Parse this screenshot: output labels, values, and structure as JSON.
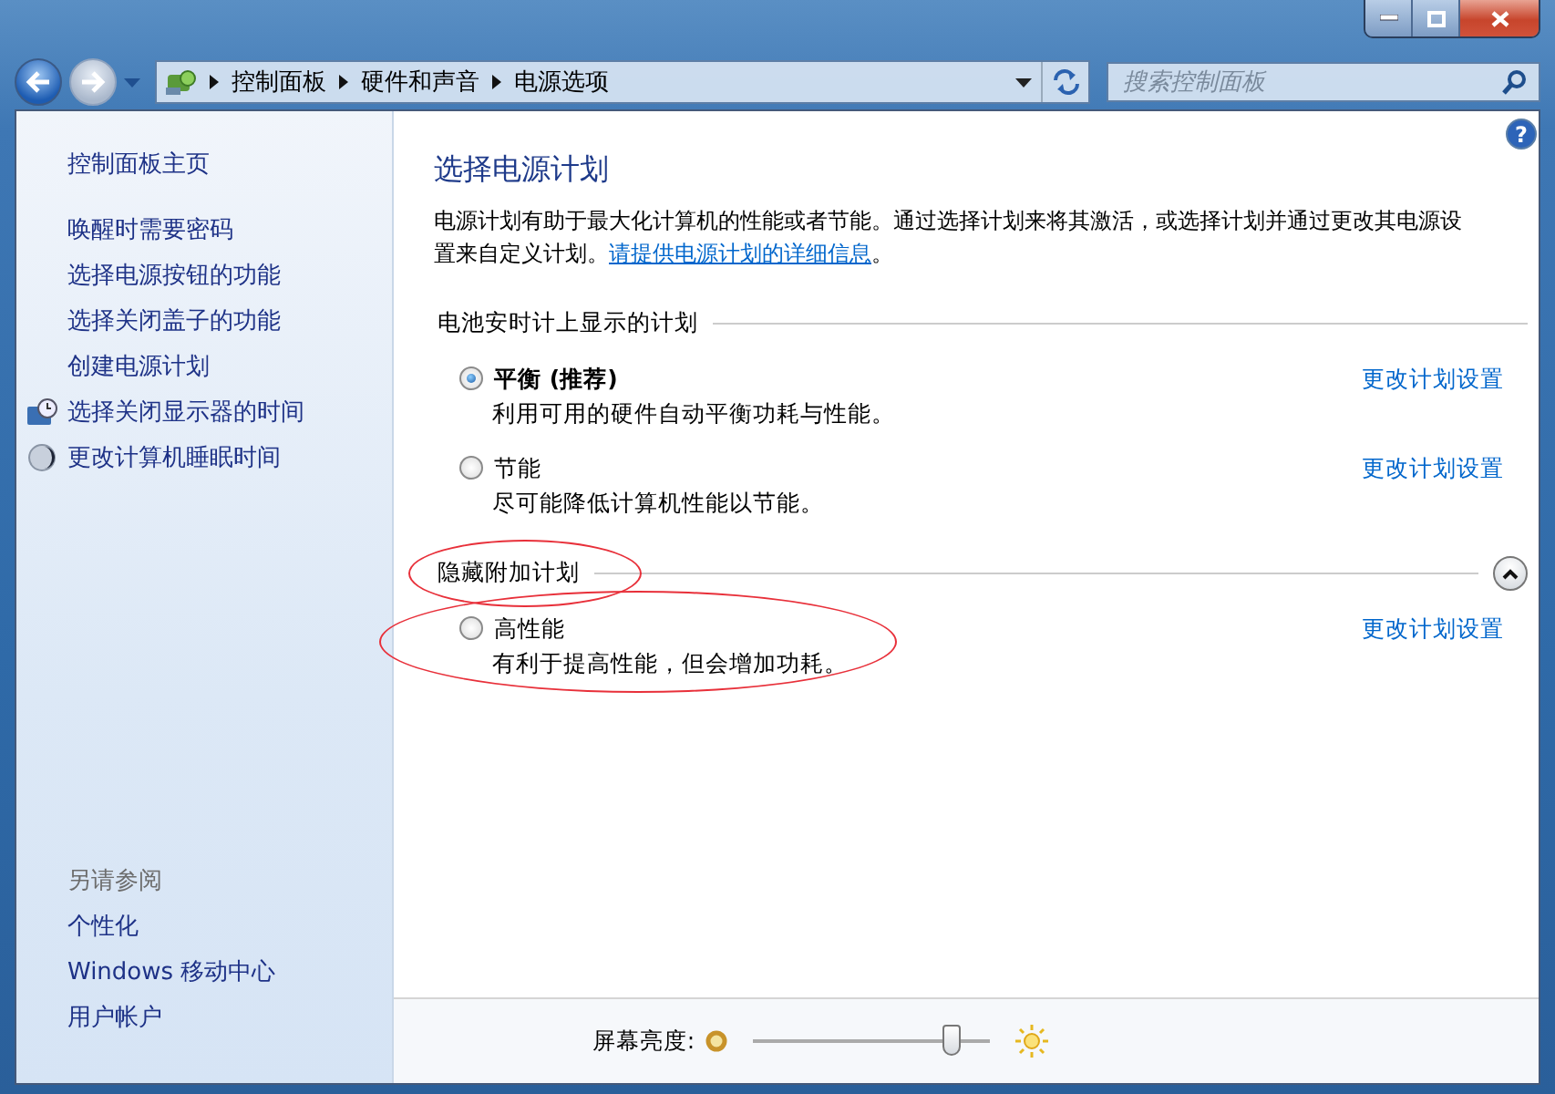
{
  "navigation": {
    "back": {
      "disabled": false
    },
    "forward": {
      "disabled": true
    },
    "breadcrumb": [
      "控制面板",
      "硬件和声音",
      "电源选项"
    ],
    "search": {
      "placeholder": "搜索控制面板"
    }
  },
  "sidebar": {
    "home": "控制面板主页",
    "tasks": [
      {
        "label": "唤醒时需要密码",
        "kind": "plain"
      },
      {
        "label": "选择电源按钮的功能",
        "kind": "plain"
      },
      {
        "label": "选择关闭盖子的功能",
        "kind": "plain"
      },
      {
        "label": "创建电源计划",
        "kind": "plain"
      },
      {
        "label": "选择关闭显示器的时间",
        "kind": "display"
      },
      {
        "label": "更改计算机睡眠时间",
        "kind": "sleep"
      }
    ],
    "see_also": {
      "title": "另请参阅",
      "items": [
        "个性化",
        "Windows 移动中心",
        "用户帐户"
      ]
    }
  },
  "main": {
    "help": "?",
    "title": "选择电源计划",
    "description": "电源计划有助于最大化计算机的性能或者节能。通过选择计划来将其激活，或选择计划并通过更改其电源设置来自定义计划。",
    "description_link": "请提供电源计划的详细信息",
    "description_end": "。",
    "sections": [
      {
        "heading": "电池安时计上显示的计划",
        "annotated": false,
        "collapsible": false,
        "plans": [
          {
            "name": "平衡 (推荐)",
            "selected": true,
            "annotated": false,
            "description": "利用可用的硬件自动平衡功耗与性能。",
            "action": "更改计划设置"
          },
          {
            "name": "节能",
            "selected": false,
            "annotated": false,
            "description": "尽可能降低计算机性能以节能。",
            "action": "更改计划设置"
          }
        ]
      },
      {
        "heading": "隐藏附加计划",
        "annotated": true,
        "collapsible": true,
        "expanded": true,
        "plans": [
          {
            "name": "高性能",
            "selected": false,
            "annotated": true,
            "description": "有利于提高性能，但会增加功耗。",
            "action": "更改计划设置"
          }
        ]
      }
    ]
  },
  "footer": {
    "brightness_label": "屏幕亮度:",
    "level": 0.84
  }
}
